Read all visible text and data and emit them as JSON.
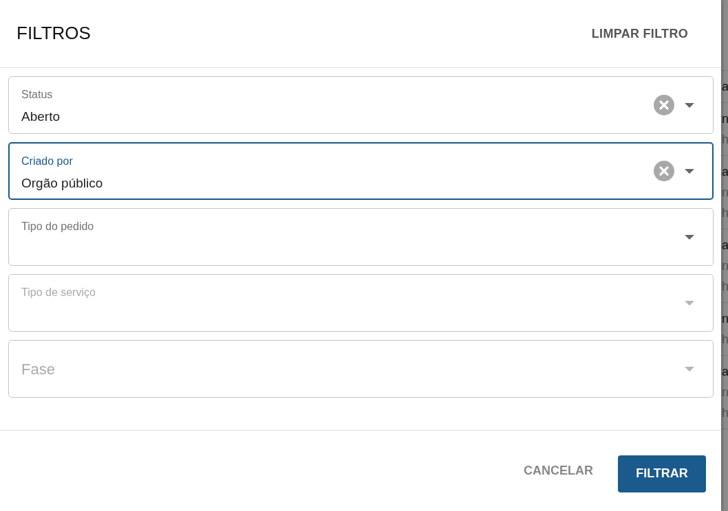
{
  "dialog": {
    "title": "FILTROS",
    "clear_button": "LIMPAR FILTRO"
  },
  "fields": [
    {
      "label": "Status",
      "value": "Aberto",
      "focused": false,
      "disabled": false
    },
    {
      "label": "Criado por",
      "value": "Orgão público",
      "focused": true,
      "disabled": false
    },
    {
      "label": "Tipo do pedido",
      "focused": false,
      "disabled": false
    },
    {
      "label": "Tipo de serviço",
      "focused": false,
      "disabled": true
    },
    {
      "placeholder": "Fase",
      "focused": false,
      "disabled": true
    }
  ],
  "footer": {
    "cancel_button": "CANCELAR",
    "submit_button": "FILTRAR"
  },
  "background_rows": [
    {
      "lines": [
        "a"
      ]
    },
    {
      "lines": [
        "n",
        "h"
      ]
    },
    {
      "lines": [
        "a",
        "n",
        "h"
      ]
    },
    {
      "lines": [
        "a",
        "n",
        "h"
      ]
    },
    {
      "lines": [
        "n",
        "h"
      ]
    },
    {
      "lines": [
        "a",
        "n",
        "h"
      ]
    }
  ]
}
